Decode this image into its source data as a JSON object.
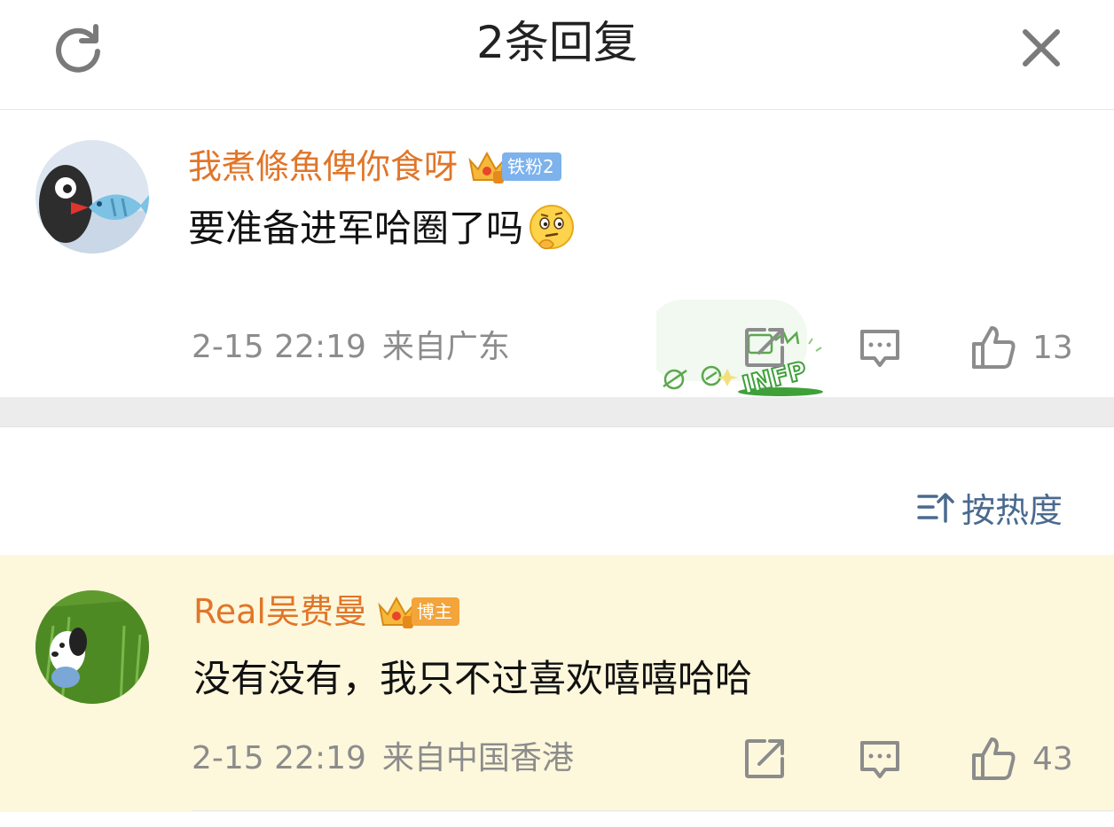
{
  "header": {
    "title": "2条回复",
    "refresh_icon": "refresh-icon",
    "close_icon": "close-icon"
  },
  "comments": [
    {
      "username": "我煮條魚俾你食呀",
      "badge": "铁粉2",
      "badge_color": "#7db2ec",
      "text": "要准备进军哈圈了吗",
      "emoji": "thinking-face-emoji",
      "sticker_text": "INFP",
      "time": "2-15 22:19",
      "location": "来自广东",
      "likes": "13"
    },
    {
      "username": "Real吴费曼",
      "badge": "博主",
      "badge_color": "#f3a43a",
      "text": "没有没有，我只不过喜欢嘻嘻哈哈",
      "time": "2-15 22:19",
      "location": "来自中国香港",
      "likes": "43"
    }
  ],
  "sort": {
    "label": "按热度",
    "icon": "sort-icon"
  },
  "colors": {
    "username": "#e0762a",
    "meta": "#8c8c8c",
    "sort_label": "#4a6a8e",
    "highlight_bg": "#fdf7dc",
    "separator": "#ececec"
  }
}
